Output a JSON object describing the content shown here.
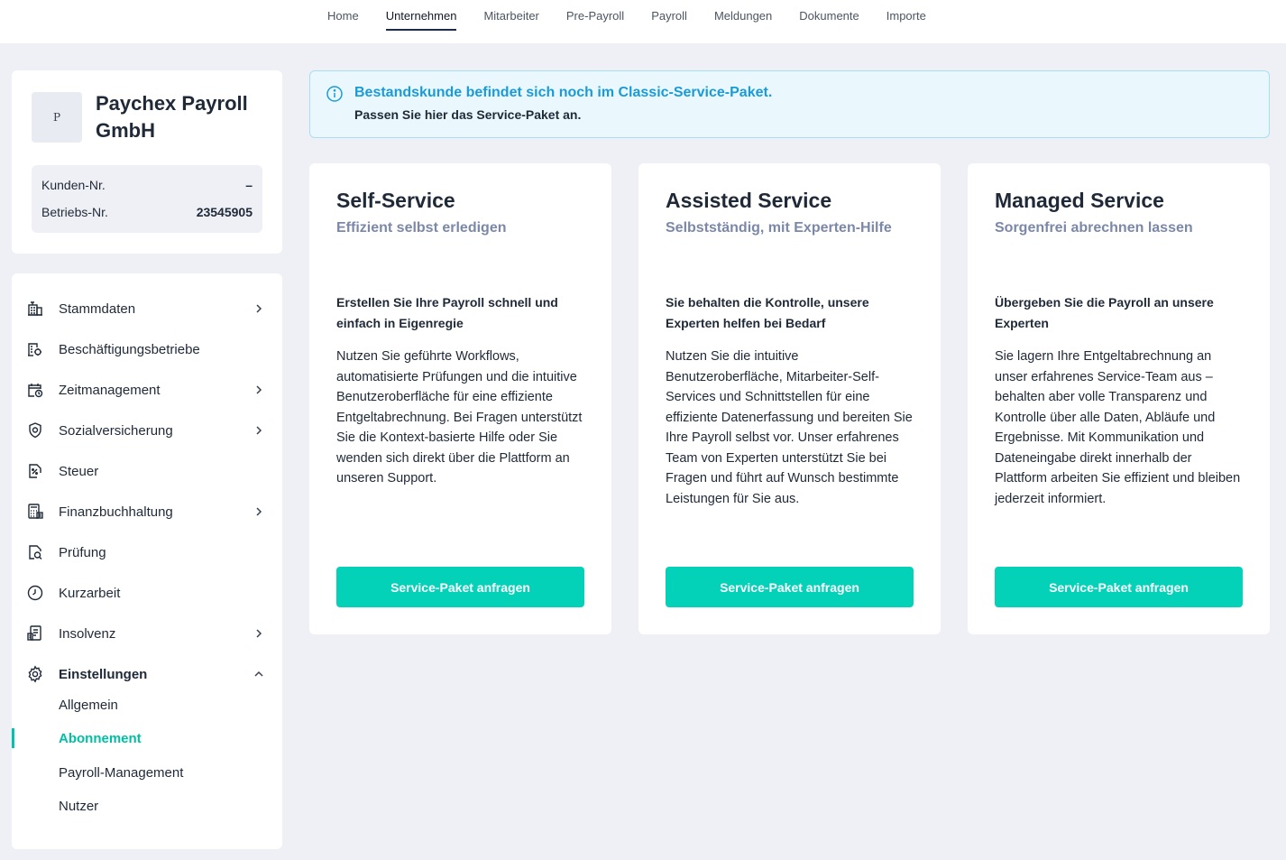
{
  "topnav": {
    "tabs": [
      "Home",
      "Unternehmen",
      "Mitarbeiter",
      "Pre-Payroll",
      "Payroll",
      "Meldungen",
      "Dokumente",
      "Importe"
    ],
    "active": "Unternehmen"
  },
  "company": {
    "logo_letter": "P",
    "name": "Paychex Payroll GmbH",
    "kunden_label": "Kunden-Nr.",
    "kunden_value": "–",
    "betriebs_label": "Betriebs-Nr.",
    "betriebs_value": "23545905"
  },
  "sidebar": {
    "items": [
      {
        "label": "Stammdaten",
        "icon": "building-icon",
        "chevron": "right"
      },
      {
        "label": "Beschäftigungsbetriebe",
        "icon": "company-settings-icon",
        "chevron": ""
      },
      {
        "label": "Zeitmanagement",
        "icon": "calendar-clock-icon",
        "chevron": "right"
      },
      {
        "label": "Sozialversicherung",
        "icon": "shield-icon",
        "chevron": "right"
      },
      {
        "label": "Steuer",
        "icon": "tax-percent-icon",
        "chevron": ""
      },
      {
        "label": "Finanzbuchhaltung",
        "icon": "calculator-icon",
        "chevron": "right"
      },
      {
        "label": "Prüfung",
        "icon": "document-search-icon",
        "chevron": ""
      },
      {
        "label": "Kurzarbeit",
        "icon": "clock-icon",
        "chevron": ""
      },
      {
        "label": "Insolvenz",
        "icon": "document-list-icon",
        "chevron": "right"
      },
      {
        "label": "Einstellungen",
        "icon": "gear-icon",
        "chevron": "up"
      }
    ],
    "subitems": [
      "Allgemein",
      "Abonnement",
      "Payroll-Management",
      "Nutzer"
    ],
    "active_subitem": "Abonnement"
  },
  "banner": {
    "title": "Bestandskunde befindet sich noch im Classic-Service-Paket.",
    "subtitle": "Passen Sie hier das Service-Paket an."
  },
  "cards": [
    {
      "title": "Self-Service",
      "subtitle": "Effizient selbst erledigen",
      "heading": "Erstellen Sie Ihre Payroll schnell und einfach in Eigenregie",
      "body": "Nutzen Sie geführte Workflows, automatisierte Prüfungen und die intuitive Benutzeroberfläche für eine effiziente Entgeltabrechnung. Bei Fragen unterstützt Sie die Kontext-basierte Hilfe oder Sie wenden sich direkt über die Plattform an unseren Support.",
      "button": "Service-Paket anfragen"
    },
    {
      "title": "Assisted Service",
      "subtitle": "Selbstständig, mit Experten-Hilfe",
      "heading": "Sie behalten die Kontrolle, unsere Experten helfen bei Bedarf",
      "body": "Nutzen Sie die intuitive Benutzeroberfläche, Mitarbeiter-Self-Services und Schnittstellen für eine effiziente Datenerfassung und bereiten Sie Ihre Payroll selbst vor. Unser erfahrenes Team von Experten unterstützt Sie bei Fragen und führt auf Wunsch bestimmte Leistungen für Sie aus.",
      "button": "Service-Paket anfragen"
    },
    {
      "title": "Managed Service",
      "subtitle": "Sorgenfrei abrechnen lassen",
      "heading": "Übergeben Sie die Payroll an unsere Experten",
      "body": "Sie lagern Ihre Entgeltabrechnung an unser erfahrenes Service-Team aus – behalten aber volle Transparenz und Kontrolle über alle Daten, Abläufe und Ergebnisse. Mit Kommunikation und Dateneingabe direkt innerhalb der Plattform arbeiten Sie effizient und bleiben jederzeit informiert.",
      "button": "Service-Paket anfragen"
    }
  ],
  "colors": {
    "accent": "#03d1b8",
    "banner_text": "#1a9bd7",
    "banner_bg": "#eaf8fd",
    "page_bg": "#eef0f6"
  }
}
